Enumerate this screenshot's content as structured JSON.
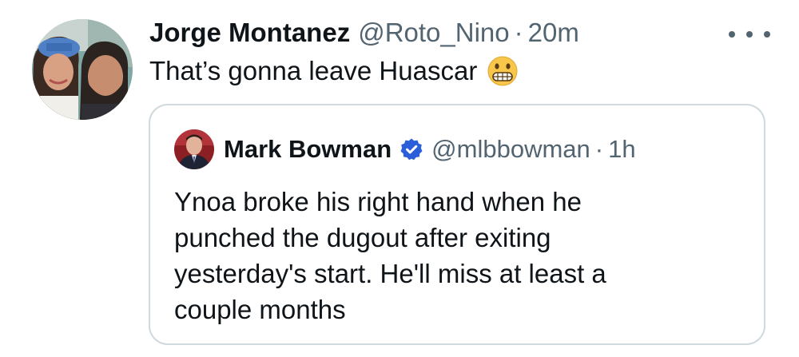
{
  "tweet": {
    "author_name": "Jorge Montanez",
    "author_handle": "@Roto_Nino",
    "separator": "·",
    "time": "20m",
    "text": "That’s gonna leave Huascar",
    "emoji_icon": "grimacing-face-icon",
    "more_icon": "more-options-icon"
  },
  "quoted_tweet": {
    "author_name": "Mark Bowman",
    "verified_icon": "verified-badge-icon",
    "author_handle": "@mlbbowman",
    "separator": "·",
    "time": "1h",
    "text_lines": [
      "Ynoa broke his right hand when he",
      "punched the dugout after exiting",
      "yesterday's start. He'll miss at least a",
      "couple months"
    ]
  },
  "colors": {
    "text_primary": "#0f1419",
    "text_secondary": "#536471",
    "border": "#cfd9de",
    "verified_blue": "#2b5fd9"
  }
}
